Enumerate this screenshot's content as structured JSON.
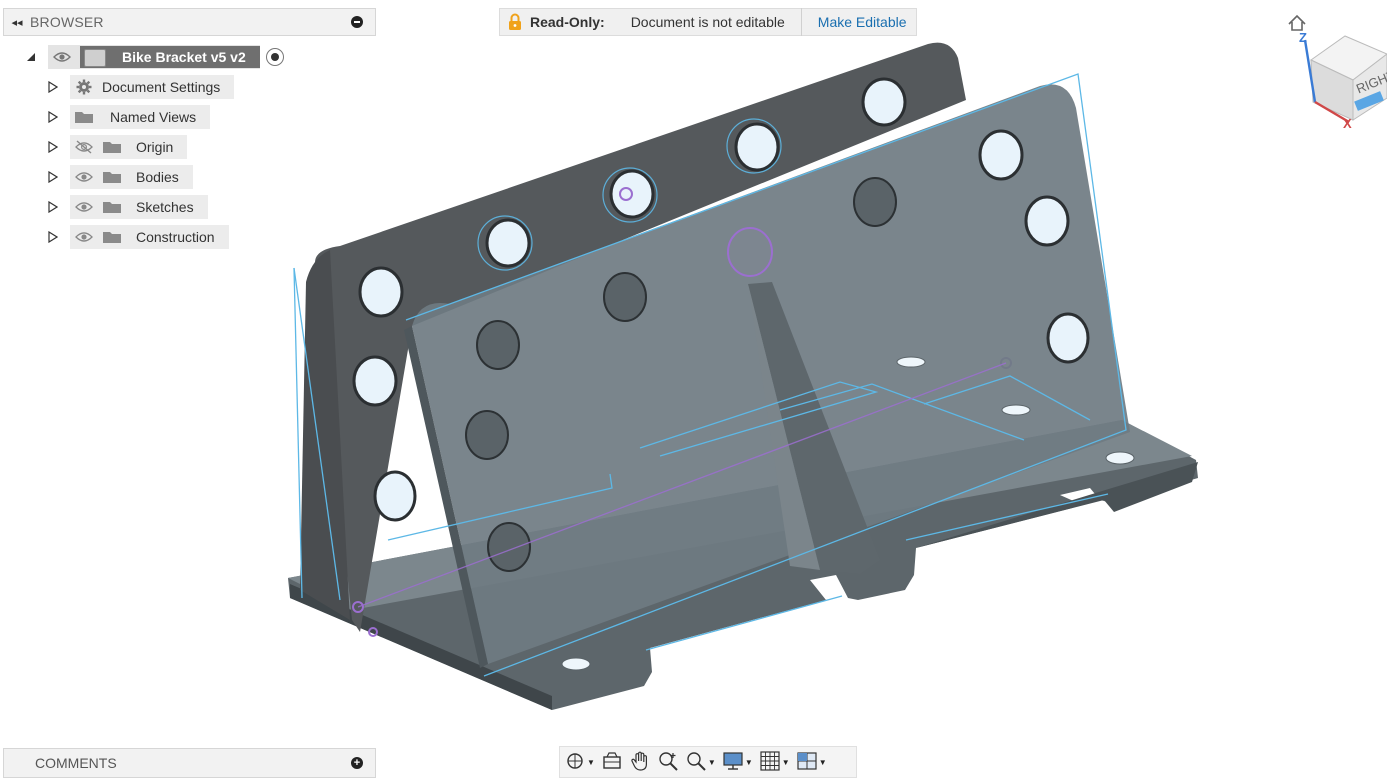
{
  "browser": {
    "collapse_glyph": "◂◂",
    "title": "BROWSER",
    "root": {
      "name": "Bike Bracket v5 v2"
    },
    "items": [
      {
        "label": "Document Settings",
        "icon": "gear-icon"
      },
      {
        "label": "Named Views",
        "icon": "folder-icon"
      },
      {
        "label": "Origin",
        "icon": "folder-icon",
        "visibility": "hidden"
      },
      {
        "label": "Bodies",
        "icon": "folder-icon",
        "visibility": "visible"
      },
      {
        "label": "Sketches",
        "icon": "folder-icon",
        "visibility": "visible"
      },
      {
        "label": "Construction",
        "icon": "folder-icon",
        "visibility": "visible"
      }
    ]
  },
  "banner": {
    "readonly_label": "Read-Only:",
    "message": "Document is not editable",
    "action": "Make Editable"
  },
  "comments": {
    "title": "COMMENTS"
  },
  "viewcube": {
    "face_label": "RIGHT",
    "axis_z": "Z",
    "axis_x": "X"
  },
  "toolbar": {
    "items": [
      "orbit-icon",
      "look-at-icon",
      "pan-icon",
      "zoom-icon",
      "fit-icon",
      "display-settings-icon",
      "grid-icon",
      "viewports-icon"
    ]
  },
  "colors": {
    "body": "#6f7b82",
    "body_dark": "#4e575c",
    "sketch_line": "#5db8e6",
    "selection": "#9b6fd0",
    "link": "#1a6fb0",
    "lock": "#f0a21b"
  }
}
